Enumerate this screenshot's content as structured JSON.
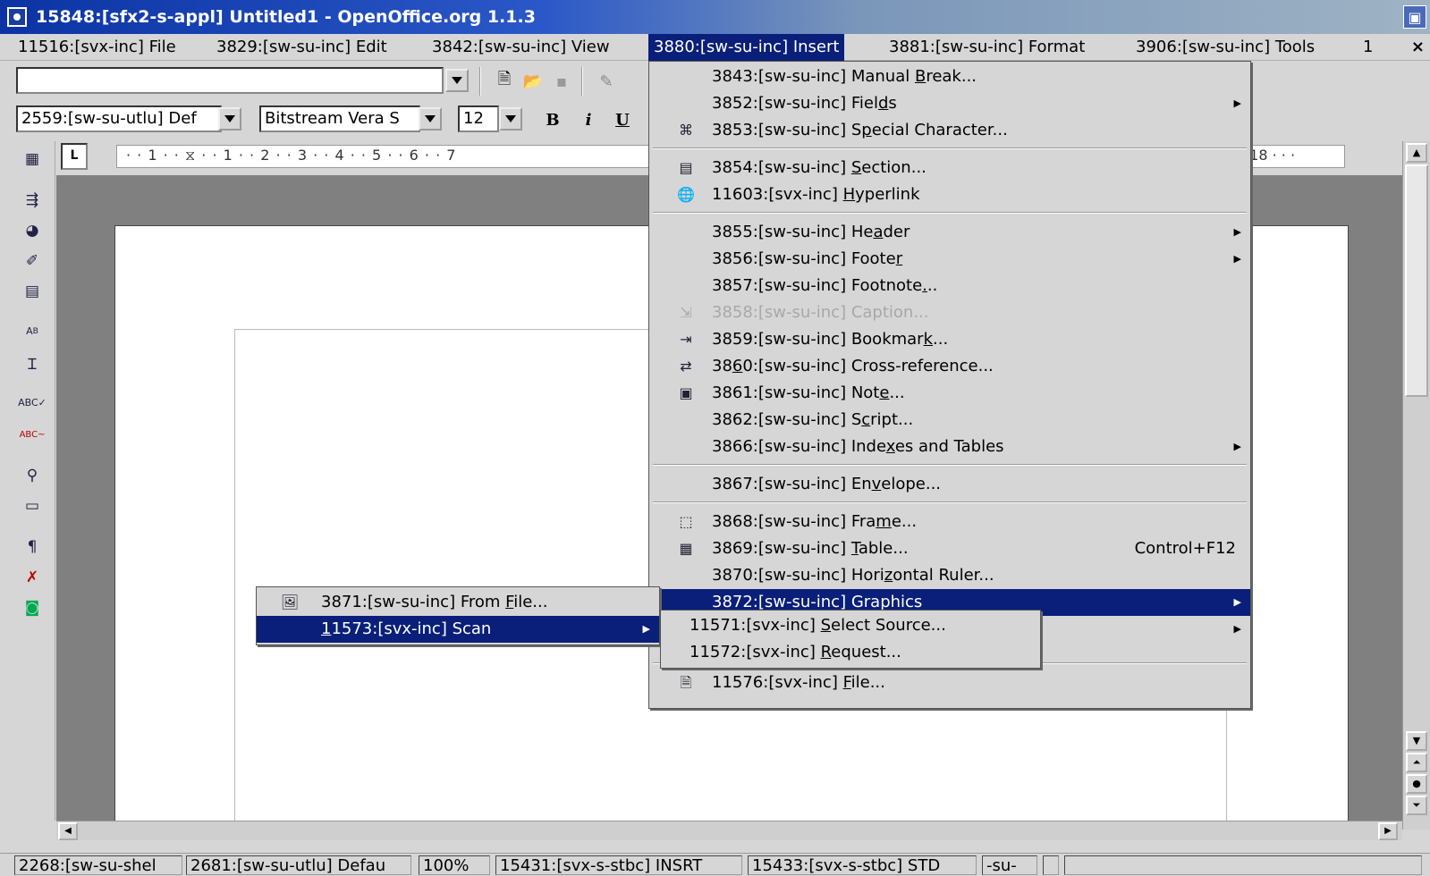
{
  "window": {
    "title": "15848:[sfx2-s-appl] Untitled1 - OpenOffice.org 1.1.3",
    "close_glyph": "×"
  },
  "menubar": {
    "items": [
      {
        "label": "11516:[svx-inc] File"
      },
      {
        "label": "3829:[sw-su-inc] Edit"
      },
      {
        "label": "3842:[sw-su-inc] View"
      },
      {
        "label": "3880:[sw-su-inc] Insert"
      },
      {
        "label": "3881:[sw-su-inc] Format"
      },
      {
        "label": "3906:[sw-su-inc] Tools"
      },
      {
        "label": "1"
      }
    ]
  },
  "toolbar": {
    "style_value": "2559:[sw-su-utlu] Def",
    "font_value": "Bitstream Vera S",
    "size_value": "12",
    "bold_label": "B",
    "italic_label": "i",
    "underline_label": "U"
  },
  "ruler": {
    "left_text": "· · 1 · · ⧖ · · 1 · · 2 · · 3 · · 4 · · 5 · · 6 · · 7",
    "right_text": "· 18 · · ·",
    "tab_marker": "L"
  },
  "insert_menu": {
    "items": [
      {
        "label": "3843:[sw-su-inc] Manual Break...",
        "icon": "",
        "submenu": false
      },
      {
        "label": "3852:[sw-su-inc] Fields",
        "icon": "",
        "submenu": true
      },
      {
        "label": "3853:[sw-su-inc] Special Character...",
        "icon": "special-character-icon",
        "submenu": false
      },
      {
        "label": "3854:[sw-su-inc] Section...",
        "icon": "section-icon",
        "submenu": false
      },
      {
        "label": "11603:[svx-inc] Hyperlink",
        "icon": "hyperlink-icon",
        "submenu": false
      },
      {
        "label": "3855:[sw-su-inc] Header",
        "icon": "",
        "submenu": true
      },
      {
        "label": "3856:[sw-su-inc] Footer",
        "icon": "",
        "submenu": true
      },
      {
        "label": "3857:[sw-su-inc] Footnote...",
        "icon": "",
        "submenu": false
      },
      {
        "label": "3858:[sw-su-inc] Caption...",
        "icon": "caption-icon",
        "submenu": false,
        "disabled": true
      },
      {
        "label": "3859:[sw-su-inc] Bookmark...",
        "icon": "bookmark-icon",
        "submenu": false
      },
      {
        "label": "3860:[sw-su-inc] Cross-reference...",
        "icon": "cross-reference-icon",
        "submenu": false
      },
      {
        "label": "3861:[sw-su-inc] Note...",
        "icon": "note-icon",
        "submenu": false
      },
      {
        "label": "3862:[sw-su-inc] Script...",
        "icon": "",
        "submenu": false
      },
      {
        "label": "3866:[sw-su-inc] Indexes and Tables",
        "icon": "",
        "submenu": true
      },
      {
        "label": "3867:[sw-su-inc] Envelope...",
        "icon": "",
        "submenu": false
      },
      {
        "label": "3868:[sw-su-inc] Frame...",
        "icon": "frame-icon",
        "submenu": false
      },
      {
        "label": "3869:[sw-su-inc] Table...",
        "icon": "table-icon",
        "submenu": false,
        "accel": "Control+F12"
      },
      {
        "label": "3870:[sw-su-inc] Horizontal Ruler...",
        "icon": "",
        "submenu": false
      },
      {
        "label": "3872:[sw-su-inc] Graphics",
        "icon": "",
        "submenu": true,
        "highlighted": true
      },
      {
        "label": "",
        "icon": "",
        "submenu": true
      },
      {
        "label": "11576:[svx-inc] File...",
        "icon": "file-icon",
        "submenu": false
      }
    ]
  },
  "graphics_submenu": {
    "items": [
      {
        "label": "3871:[sw-su-inc] From File...",
        "icon": "from-file-icon"
      },
      {
        "label": "11573:[svx-inc] Scan",
        "submenu": true,
        "highlighted": true
      }
    ]
  },
  "scan_submenu": {
    "items": [
      {
        "label": "11571:[svx-inc] Select Source..."
      },
      {
        "label": "11572:[svx-inc] Request..."
      }
    ]
  },
  "statusbar": {
    "fields": [
      "2268:[sw-su-shel",
      "2681:[sw-su-utlu] Defau",
      "100%",
      "15431:[svx-s-stbc] INSRT",
      "15433:[svx-s-stbc] STD",
      "-su-"
    ]
  },
  "colors": {
    "menu_highlight": "#0a1f7a",
    "title_start": "#0b33a4",
    "doc_bg": "#808080"
  }
}
